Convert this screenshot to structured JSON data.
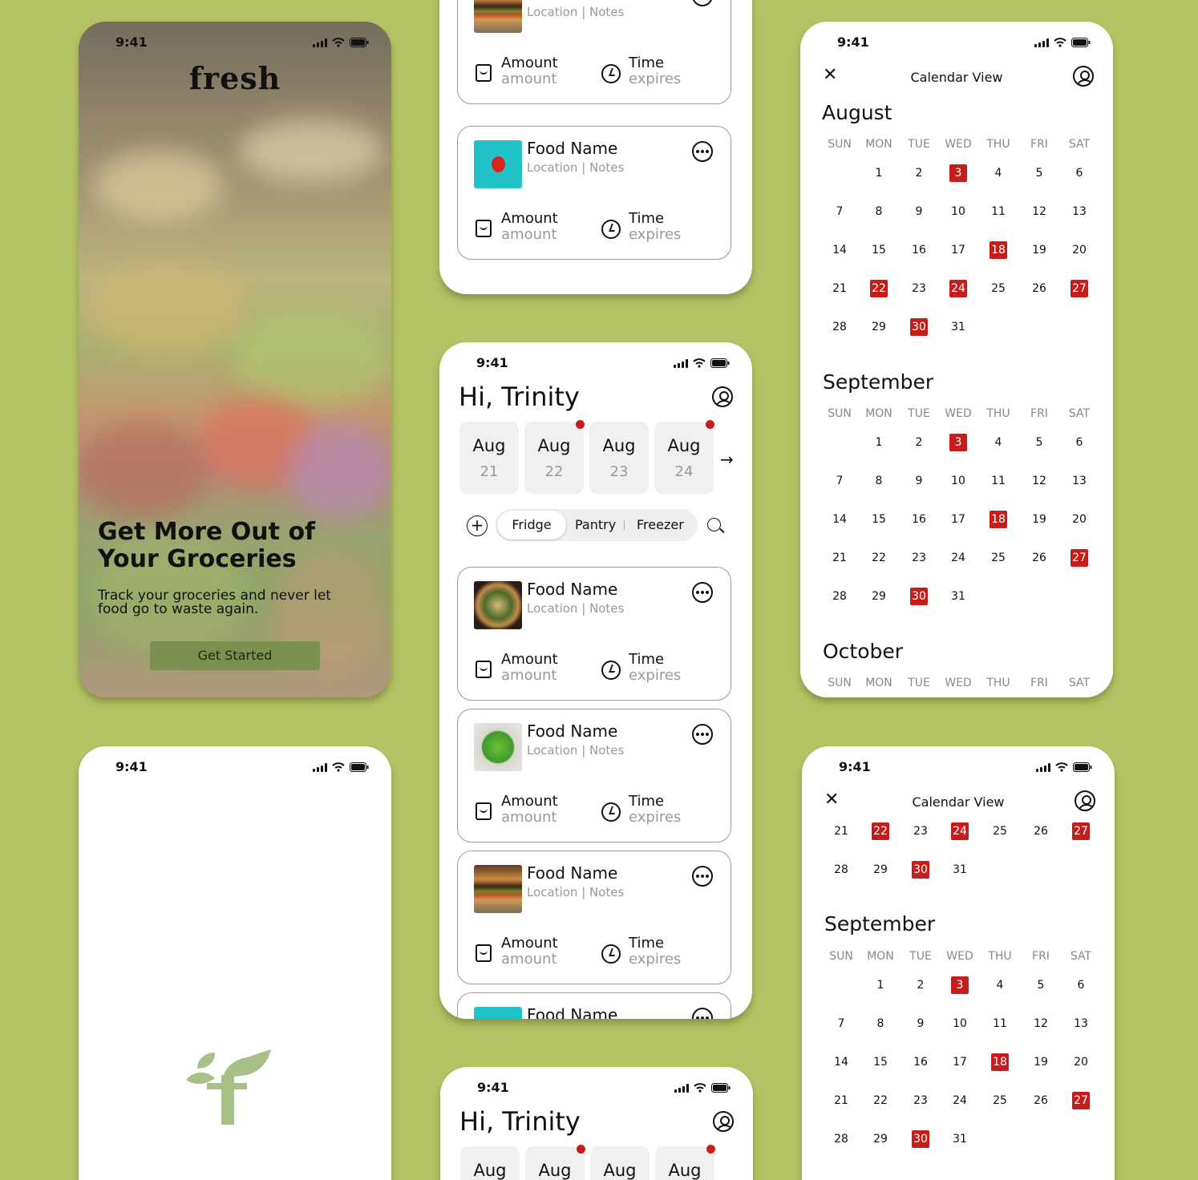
{
  "status_time": "9:41",
  "onboarding": {
    "logo": "fresh",
    "headline_1": "Get More Out of",
    "headline_2": "Your Groceries",
    "subtitle": "Track your groceries and never let food go to waste again.",
    "cta": "Get Started"
  },
  "food_card": {
    "name": "Food Name",
    "location_notes": "Location | Notes",
    "amount_label": "Amount",
    "amount_value": "amount",
    "time_label": "Time",
    "time_value": "expires"
  },
  "home": {
    "greeting": "Hi, Trinity",
    "days": [
      {
        "month": "Aug",
        "day": "21",
        "has_alert": false
      },
      {
        "month": "Aug",
        "day": "22",
        "has_alert": true
      },
      {
        "month": "Aug",
        "day": "23",
        "has_alert": false
      },
      {
        "month": "Aug",
        "day": "24",
        "has_alert": true
      }
    ],
    "tabs": [
      "Fridge",
      "Pantry",
      "Freezer"
    ],
    "active_tab": "Fridge",
    "food_images": [
      "burger",
      "tomato",
      "pizza",
      "salad",
      "burger",
      "teal"
    ]
  },
  "calendar": {
    "title": "Calendar View",
    "weekdays": [
      "SUN",
      "MON",
      "TUE",
      "WED",
      "THU",
      "FRI",
      "SAT"
    ],
    "months": [
      "August",
      "September",
      "October"
    ],
    "august_highlights": [
      3,
      18,
      22,
      24,
      27,
      30
    ],
    "september_highlights": [
      3,
      18,
      27,
      30
    ]
  },
  "colors": {
    "background": "#b5c264",
    "accent_red": "#c51c1c",
    "cta_green": "#7c9150",
    "logo_green": "#a8bf86"
  }
}
